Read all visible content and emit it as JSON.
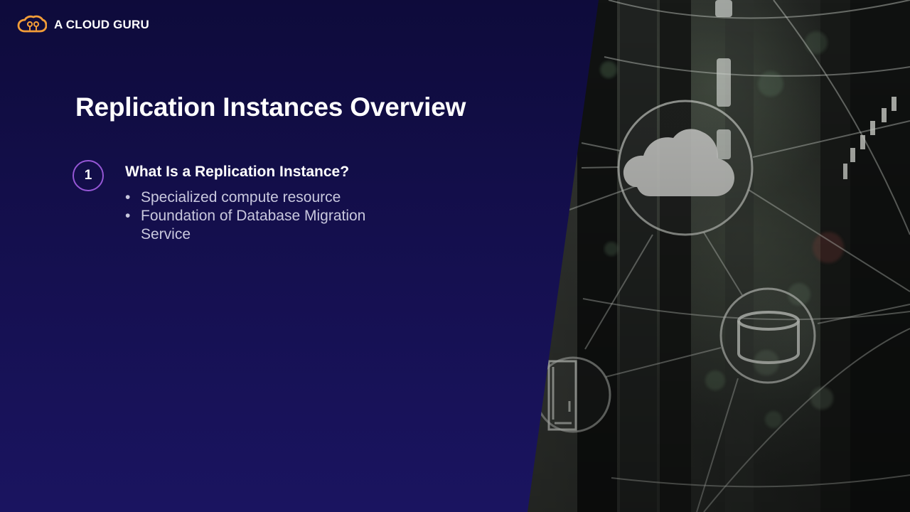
{
  "brand": {
    "logo_text": "A CLOUD GURU",
    "logo_icon": "cloud-logo-icon",
    "accent": "#f29d38"
  },
  "slide": {
    "title": "Replication Instances Overview",
    "section": {
      "number": "1",
      "heading": "What Is a Replication Instance?",
      "bullets": [
        "Specialized compute resource",
        "Foundation of Database Migration Service"
      ]
    }
  },
  "visual": {
    "left_panel_color": "#140f4d",
    "ring_color": "#9657d6",
    "illustration_icons": [
      "server-rack-background",
      "cloud-icon",
      "database-icon",
      "server-icon"
    ]
  }
}
